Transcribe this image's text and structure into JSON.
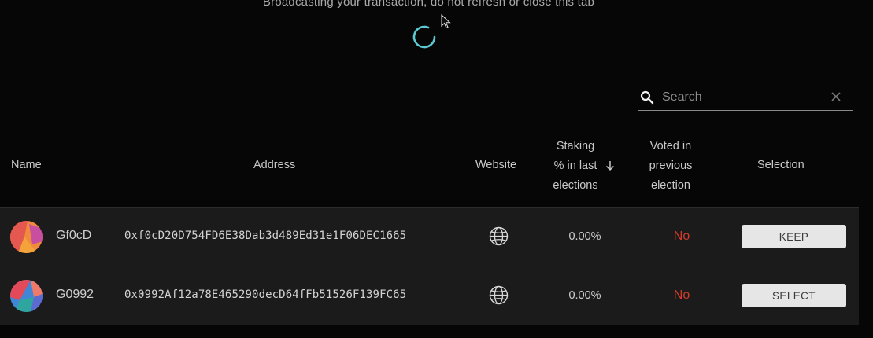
{
  "banner": {
    "message": "Broadcasting your transaction, do not refresh or close this tab"
  },
  "search": {
    "placeholder": "Search",
    "value": ""
  },
  "table": {
    "headers": {
      "name": "Name",
      "address": "Address",
      "website": "Website",
      "staking": [
        "Staking",
        "% in last",
        "elections"
      ],
      "voted": [
        "Voted in",
        "previous",
        "election"
      ],
      "selection": "Selection"
    },
    "rows": [
      {
        "name": "Gf0cD",
        "address": "0xf0cD20D754FD6E38Dab3d489Ed31e1F06DEC1665",
        "website_icon": "globe-icon",
        "staking": "0.00%",
        "voted": "No",
        "action": "KEEP"
      },
      {
        "name": "G0992",
        "address": "0x0992Af12a78E465290decD64fFb51526F139FC65",
        "website_icon": "globe-icon",
        "staking": "0.00%",
        "voted": "No",
        "action": "SELECT"
      }
    ]
  },
  "colors": {
    "background": "#060606",
    "row_background": "#1b1b1b",
    "spinner": "#5bc8d2",
    "voted_no": "#d23a2a",
    "button_background": "#e6e6e6"
  }
}
